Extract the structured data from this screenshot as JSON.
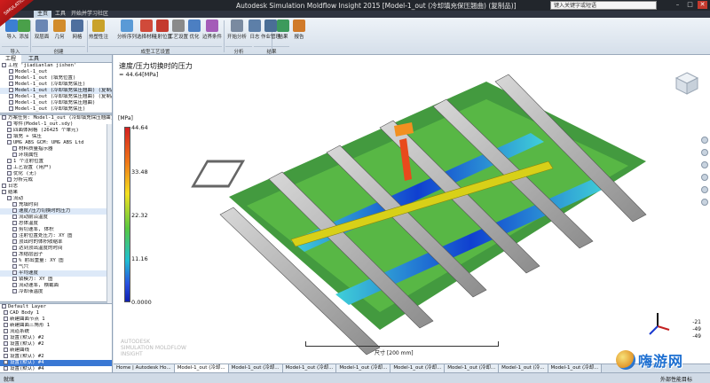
{
  "app": {
    "title": "Autodesk Simulation Moldflow Insight 2015   [Model-1_out (冷却填充保压翘曲) (复制品)]",
    "badge": "SIMULATION",
    "search_placeholder": "键入关键字或短语"
  },
  "tabs": [
    "主页",
    "工具",
    "开始并学习",
    "社区"
  ],
  "ribbon": {
    "buttons": [
      {
        "label": "导入",
        "icon": "import-icon",
        "color": "#3c7fd1"
      },
      {
        "label": "添加",
        "icon": "add-icon",
        "color": "#4aa04a"
      },
      {
        "label": "双层面",
        "icon": "dual-surface-icon",
        "color": "#6a86b4"
      },
      {
        "label": "几何",
        "icon": "geometry-icon",
        "color": "#d28c2c"
      },
      {
        "label": "网格",
        "icon": "mesh-icon",
        "color": "#4e6f9e"
      },
      {
        "label": "热塑性注塑成型",
        "icon": "molding-icon",
        "color": "#c9a22a"
      },
      {
        "label": "分析序列",
        "icon": "sequence-icon",
        "color": "#5a9ad6"
      },
      {
        "label": "选择材料",
        "icon": "material-icon",
        "color": "#d04a3a"
      },
      {
        "label": "注射位置",
        "icon": "injection-icon",
        "color": "#c43a2e"
      },
      {
        "label": "工艺设置",
        "icon": "process-icon",
        "color": "#8a8a8a"
      },
      {
        "label": "优化",
        "icon": "optimize-icon",
        "color": "#4c7fc2"
      },
      {
        "label": "边界条件",
        "icon": "boundary-icon",
        "color": "#a45cb8"
      },
      {
        "label": "开始分析",
        "icon": "start-analysis-icon",
        "color": "#7a8aa0"
      },
      {
        "label": "日志",
        "icon": "log-icon",
        "color": "#5d7fa8"
      },
      {
        "label": "作业管理器",
        "icon": "job-manager-icon",
        "color": "#4a6e96"
      },
      {
        "label": "结果",
        "icon": "results-icon",
        "color": "#3c9a5c"
      },
      {
        "label": "报告",
        "icon": "report-icon",
        "color": "#d07a2a"
      }
    ],
    "groups": [
      "导入",
      "创建",
      "成型工艺设置",
      "分析",
      "结果"
    ]
  },
  "left_panel": {
    "tabs": [
      "工程",
      "工具"
    ],
    "project_tree": [
      "工程 'jiadianlan jishen'",
      "Model-1_out",
      "Model-1_out (填充位置)",
      "Model-1_out (冷却填充保压)",
      "Model-1_out (冷却填充保压翘曲) (复制品)",
      "Model-1_out (冷却填充保压翘曲) (复制品)",
      "Model-1_out (冷却填充保压翘曲)",
      "Model-1_out (冷却填充保压)"
    ],
    "study_tree": [
      "方案任务: Model-1_out (冷却填充保压翘曲)",
      "零件(Model-1_out.sdy)",
      "四面体网格 (26425 个单元)",
      "填充 + 保压",
      "UMG ABS GCM: UMG ABS Ltd",
      "材料质量指示器",
      "环境属性",
      "1 个注射位置",
      "工艺设置 (用户)",
      "优化 (无)",
      "分析完成",
      "日志",
      "结果",
      "流动",
      "充填时间",
      "速度/压力切换时的压力",
      "流动前沿温度",
      "总体温度",
      "剪切速率, 体积",
      "注射位置处压力: XY 图",
      "顶出时的体积收缩率",
      "达到顶出温度的时间",
      "冻结层因子",
      "% 射出重量: XY 图",
      "气穴",
      "平均速度",
      "锁模力: XY 图",
      "流动速率, 横截面",
      "冷却液温度"
    ],
    "layers": [
      "Default Layer",
      "CAD Body 1",
      "新建曲面节点 1",
      "新建曲面三角形 1",
      "流道系统",
      "设置(默认) #2",
      "设置(默认) #2",
      "新建曲线",
      "设置(默认) #2",
      "设置(默认) #4",
      "设置(默认) #4"
    ]
  },
  "viewport": {
    "result_title": "速度/压力切换时的压力",
    "result_value": "= 44.64[MPa]",
    "legend_unit": "[MPa]",
    "legend_ticks": [
      "44.64",
      "33.48",
      "22.32",
      "11.16",
      "0.0000"
    ],
    "scale_label": "尺寸 [200 mm]",
    "watermark": "AUTODESK\nSIMULATION MOLDFLOW\nINSIGHT",
    "triad_values": [
      "-21",
      "-49",
      "-49"
    ]
  },
  "doc_tabs": [
    "Home | Autodesk Ho...",
    "Model-1_out (冷却...",
    "Model-1_out (冷却...",
    "Model-1_out (冷却...",
    "Model-1_out (冷却...",
    "Model-1_out (冷却...",
    "Model-1_out (冷却...",
    "Model-1_out (冷...",
    "Model-1_out (冷却..."
  ],
  "status": {
    "left": "就绪",
    "right": "外部性能目标"
  },
  "site_logo": "嗨游网"
}
